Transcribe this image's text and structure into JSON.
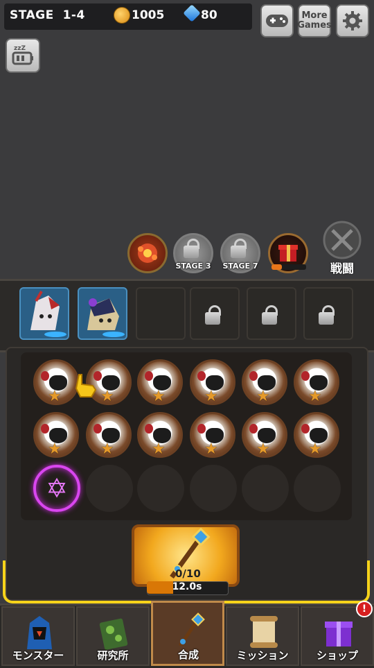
{
  "status": {
    "stage_label": "STAGE",
    "stage_value": "1-4",
    "gold": "1005",
    "gems": "80"
  },
  "top_buttons": {
    "more_games_label": "More\nGames"
  },
  "stage_path": [
    {
      "kind": "cleared",
      "icon": "fire-flower-icon",
      "label": ""
    },
    {
      "kind": "locked",
      "icon": "lock-icon",
      "label": "STAGE 3"
    },
    {
      "kind": "locked",
      "icon": "lock-icon",
      "label": "STAGE 7"
    },
    {
      "kind": "current",
      "icon": "gift-box-icon",
      "label": ""
    }
  ],
  "battle_button": {
    "label": "戦闘"
  },
  "team_slots": [
    "filled",
    "filled",
    "empty",
    "locked",
    "locked",
    "locked"
  ],
  "board": {
    "rows": [
      [
        "monster",
        "monster",
        "monster",
        "monster",
        "monster",
        "monster"
      ],
      [
        "monster",
        "monster",
        "monster",
        "monster",
        "monster",
        "monster"
      ],
      [
        "portal",
        "empty",
        "empty",
        "empty",
        "empty",
        "empty"
      ]
    ],
    "monster_star": "★"
  },
  "summon": {
    "count": "0/10",
    "timer": "12.0s",
    "progress": 0.33
  },
  "nav": [
    {
      "label": "モンスター",
      "icon": "hooded-monster-icon",
      "active": false
    },
    {
      "label": "研究所",
      "icon": "research-book-icon",
      "active": false
    },
    {
      "label": "合成",
      "icon": "staff-icon",
      "active": true
    },
    {
      "label": "ミッション",
      "icon": "scroll-icon",
      "active": false
    },
    {
      "label": "ショップ",
      "icon": "gift-box-icon",
      "active": false
    }
  ],
  "shop_badge": "!",
  "colors": {
    "accent_yellow": "#f6d31a",
    "portal_purple": "#d946ef",
    "slot_blue": "#2a5f86"
  }
}
